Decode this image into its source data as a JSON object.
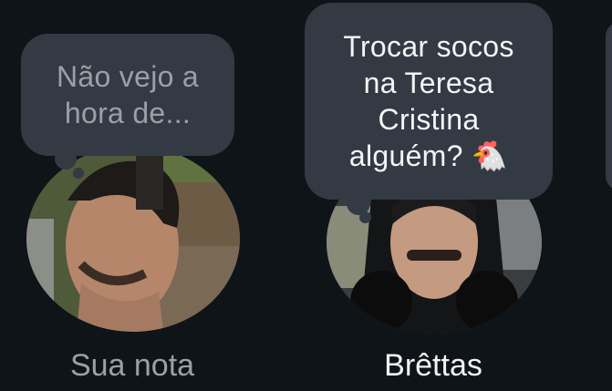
{
  "notes": [
    {
      "owner": "Sua nota",
      "text": "Não vejo a\nhora de...",
      "is_placeholder": true
    },
    {
      "owner": "Brêttas",
      "text": "Trocar socos\nna Teresa\nCristina\nalguém? 🐔",
      "is_placeholder": false
    }
  ],
  "colors": {
    "background": "#0f1419",
    "bubble": "#343a43",
    "text_primary": "#f1f2f4",
    "text_muted": "#9aa0a8"
  }
}
